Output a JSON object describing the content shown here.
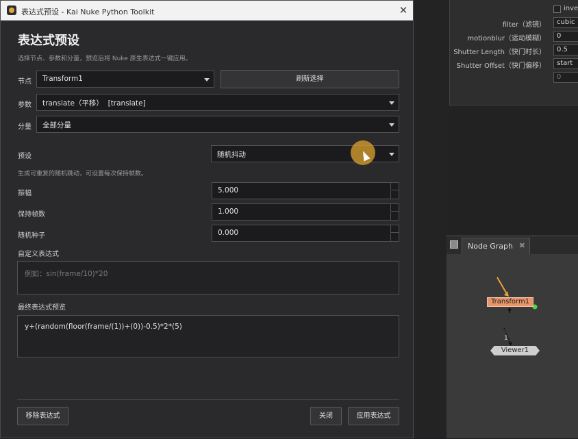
{
  "window": {
    "title": "表达式预设 - Kai Nuke Python Toolkit"
  },
  "dialog": {
    "heading": "表达式预设",
    "subheading": "选择节点、参数和分量，预览后将 Nuke 原生表达式一键应用。",
    "node": {
      "label": "节点",
      "value": "Transform1",
      "refresh_label": "刷新选择"
    },
    "param": {
      "label": "参数",
      "value": "translate（平移）  [translate]"
    },
    "component": {
      "label": "分量",
      "value": "全部分量"
    },
    "preset": {
      "label": "预设",
      "value": "随机抖动",
      "description": "生成可重复的随机跳动，可设置每次保持帧数。"
    },
    "fields": [
      {
        "label": "振幅",
        "value": "5.000"
      },
      {
        "label": "保持帧数",
        "value": "1.000"
      },
      {
        "label": "随机种子",
        "value": "0.000"
      }
    ],
    "custom": {
      "label": "自定义表达式",
      "placeholder": "例如：sin(frame/10)*20"
    },
    "preview": {
      "label": "最终表达式预览",
      "value": "y+(random(floor(frame/(1))+(0))-0.5)*2*(5)"
    },
    "buttons": {
      "remove": "移除表达式",
      "close": "关闭",
      "apply": "应用表达式"
    }
  },
  "properties_panel": {
    "rows": [
      {
        "label": "",
        "value": "inve"
      },
      {
        "label": "filter（滤镜）",
        "value": "cubic"
      },
      {
        "label": "motionblur（运动模糊）",
        "value": "0"
      },
      {
        "label": "Shutter Length（快门时长）",
        "value": "0.5"
      },
      {
        "label": "Shutter Offset（快门偏移）",
        "value": "start"
      },
      {
        "label": "",
        "value": "0"
      }
    ]
  },
  "node_graph": {
    "tab": "Node Graph",
    "nodes": {
      "transform": "Transform1",
      "viewer": "Viewer1",
      "viewer_input": "1"
    }
  },
  "colors": {
    "accent": "#e8956a",
    "cursor_halo": "#d69e2e",
    "dialog_bg": "#2a2a2c"
  }
}
